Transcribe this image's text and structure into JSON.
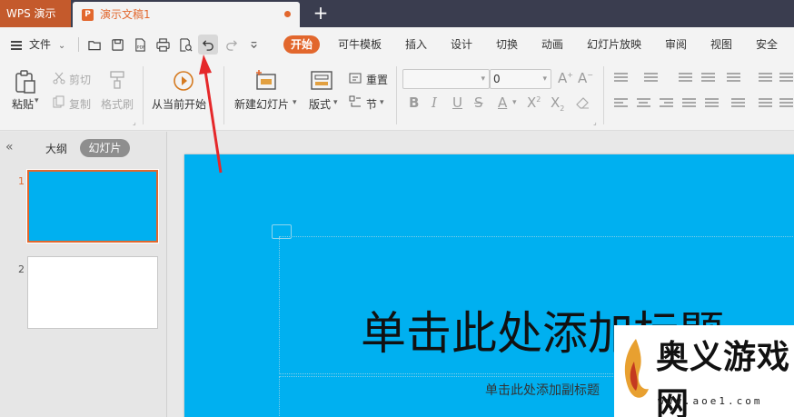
{
  "titlebar": {
    "app_name": "WPS 演示",
    "document_name": "演示文稿1",
    "new_tab_symbol": "+"
  },
  "menubar": {
    "file_label": "文件",
    "tabs": [
      "开始",
      "可牛模板",
      "插入",
      "设计",
      "切换",
      "动画",
      "幻灯片放映",
      "审阅",
      "视图",
      "安全"
    ],
    "active_tab": "开始",
    "accent_color": "#e2672d"
  },
  "ribbon": {
    "paste": "粘贴",
    "cut": "剪切",
    "copy": "复制",
    "format_painter": "格式刷",
    "play_from_current": "从当前开始",
    "new_slide": "新建幻灯片",
    "layout": "版式",
    "reset": "重置",
    "section": "节",
    "font_size_value": "0"
  },
  "leftpane": {
    "outline_tab": "大纲",
    "slides_tab": "幻灯片",
    "slide_numbers": [
      "1",
      "2"
    ],
    "slide1_color": "#00b0f0"
  },
  "slide": {
    "background_color": "#00b0f0",
    "title_placeholder": "单击此处添加标题",
    "subtitle_placeholder": "单击此处添加副标题"
  },
  "watermark": {
    "title": "奥义游戏网",
    "url": "www.aoe1.com"
  }
}
